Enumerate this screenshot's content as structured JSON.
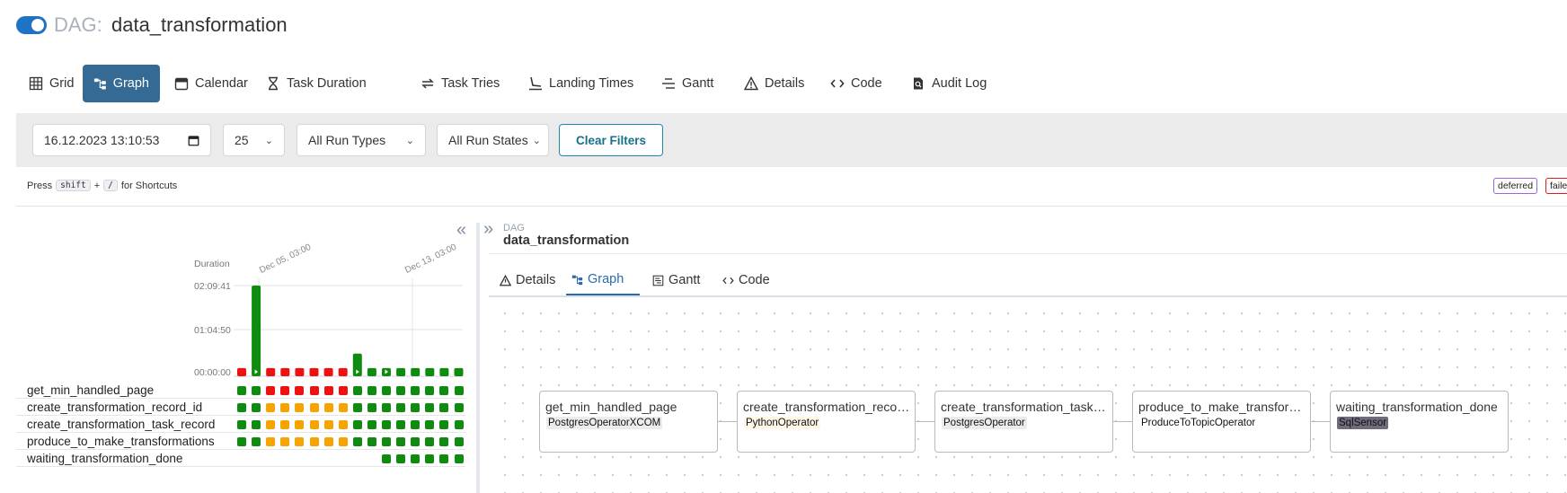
{
  "header": {
    "prefix": "DAG:",
    "dag_id": "data_transformation"
  },
  "nav": [
    {
      "label": "Grid",
      "icon": "grid-icon"
    },
    {
      "label": "Graph",
      "icon": "graph-icon",
      "active": true
    },
    {
      "label": "Calendar",
      "icon": "calendar-icon"
    },
    {
      "label": "Task Duration",
      "icon": "hourglass-icon"
    },
    {
      "label": "Task Tries",
      "icon": "retry-icon"
    },
    {
      "label": "Landing Times",
      "icon": "landing-icon"
    },
    {
      "label": "Gantt",
      "icon": "gantt-icon"
    },
    {
      "label": "Details",
      "icon": "warning-triangle-icon"
    },
    {
      "label": "Code",
      "icon": "code-icon"
    },
    {
      "label": "Audit Log",
      "icon": "audit-log-icon"
    }
  ],
  "filters": {
    "base_date": "16.12.2023 13:10:53",
    "num_runs": "25",
    "run_type": "All Run Types",
    "run_state": "All Run States",
    "clear_label": "Clear Filters"
  },
  "shortcuts": {
    "press": "Press",
    "key1": "shift",
    "plus": "+",
    "key2": "/",
    "suffix": "for Shortcuts"
  },
  "state_legend": [
    {
      "label": "deferred",
      "color": "#9b68d9"
    },
    {
      "label": "faile",
      "color": "#e21a1a"
    }
  ],
  "grid": {
    "duration_label": "Duration",
    "y_ticks": [
      "02:09:41",
      "01:04:50",
      "00:00:00"
    ],
    "date_labels": [
      "Dec 05, 03:00",
      "Dec 13, 03:00"
    ],
    "collapse_icon": "«",
    "run_bars": [
      {
        "state": "failed",
        "duration": 0.09
      },
      {
        "state": "success",
        "duration": 1.0,
        "play": true
      },
      {
        "state": "failed",
        "duration": 0.09
      },
      {
        "state": "failed",
        "duration": 0.09
      },
      {
        "state": "failed",
        "duration": 0.09
      },
      {
        "state": "failed",
        "duration": 0.09
      },
      {
        "state": "failed",
        "duration": 0.09
      },
      {
        "state": "failed",
        "duration": 0.09
      },
      {
        "state": "success",
        "duration": 0.25,
        "play": true
      },
      {
        "state": "success",
        "duration": 0.09
      },
      {
        "state": "success",
        "duration": 0.09,
        "play": true
      },
      {
        "state": "success",
        "duration": 0.09
      },
      {
        "state": "success",
        "duration": 0.09
      },
      {
        "state": "success",
        "duration": 0.09
      },
      {
        "state": "success",
        "duration": 0.09
      },
      {
        "state": "success",
        "duration": 0.09
      }
    ],
    "tasks": [
      {
        "name": "get_min_handled_page",
        "states": "ggrrrrrrgggggggg"
      },
      {
        "name": "create_transformation_record_id",
        "states": "ggoooooogggggggg"
      },
      {
        "name": "create_transformation_task_record",
        "states": "ggoooooogggggggg"
      },
      {
        "name": "produce_to_make_transformations",
        "states": "ggoooooogggggggg"
      },
      {
        "name": "waiting_transformation_done",
        "states": "----------gggggg"
      }
    ]
  },
  "detail": {
    "expand_icon": "»",
    "breadcrumb_label": "DAG",
    "dag_id": "data_transformation",
    "tabs": [
      {
        "label": "Details",
        "icon": "warning-triangle-icon"
      },
      {
        "label": "Graph",
        "icon": "graph-icon",
        "active": true
      },
      {
        "label": "Gantt",
        "icon": "gantt-icon"
      },
      {
        "label": "Code",
        "icon": "code-icon"
      }
    ],
    "nodes": [
      {
        "title": "get_min_handled_page",
        "operator": "PostgresOperatorXCOM",
        "op_color": "#ececec"
      },
      {
        "title": "create_transformation_record_id",
        "operator": "PythonOperator",
        "op_color": "#fff7e8"
      },
      {
        "title": "create_transformation_task_record",
        "operator": "PostgresOperator",
        "op_color": "#ececec"
      },
      {
        "title": "produce_to_make_transformations",
        "operator": "ProduceToTopicOperator",
        "op_color": "#ffffff"
      },
      {
        "title": "waiting_transformation_done",
        "operator": "SqlSensor",
        "op_color": "#716b7e"
      }
    ]
  }
}
